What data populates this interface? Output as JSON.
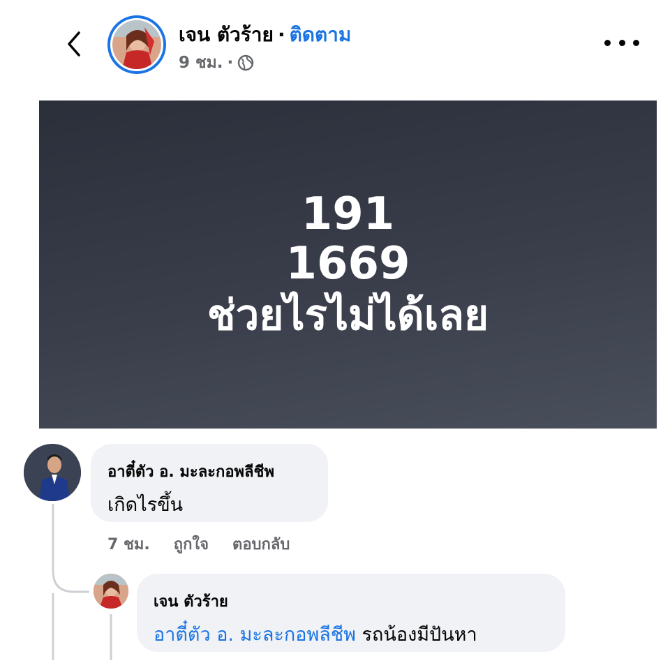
{
  "header": {
    "author": "เจน ตัวร้าย",
    "separator": "·",
    "follow": "ติดตาม",
    "time": "9 ชม.",
    "time_sep": "·",
    "back_icon": "chevron-left-icon",
    "more_icon": "more-horizontal-icon",
    "privacy_icon": "globe-icon",
    "accent_color": "#1b74e4"
  },
  "post": {
    "lines": [
      "191",
      "1669",
      "ช่วยไรไม่ได้เลย"
    ],
    "background": "#2b2f3a"
  },
  "comments": [
    {
      "author": "อาตี๋ตัว อ. มะละกอพลีชีพ",
      "text": "เกิดไรขึ้น",
      "time": "7 ชม.",
      "like": "ถูกใจ",
      "reply": "ตอบกลับ"
    }
  ],
  "replies": [
    {
      "author": "เจน ตัวร้าย",
      "mention": "อาตี๋ตัว อ. มะละกอพลีชีพ",
      "text": "รถน้องมีปันหา"
    }
  ]
}
